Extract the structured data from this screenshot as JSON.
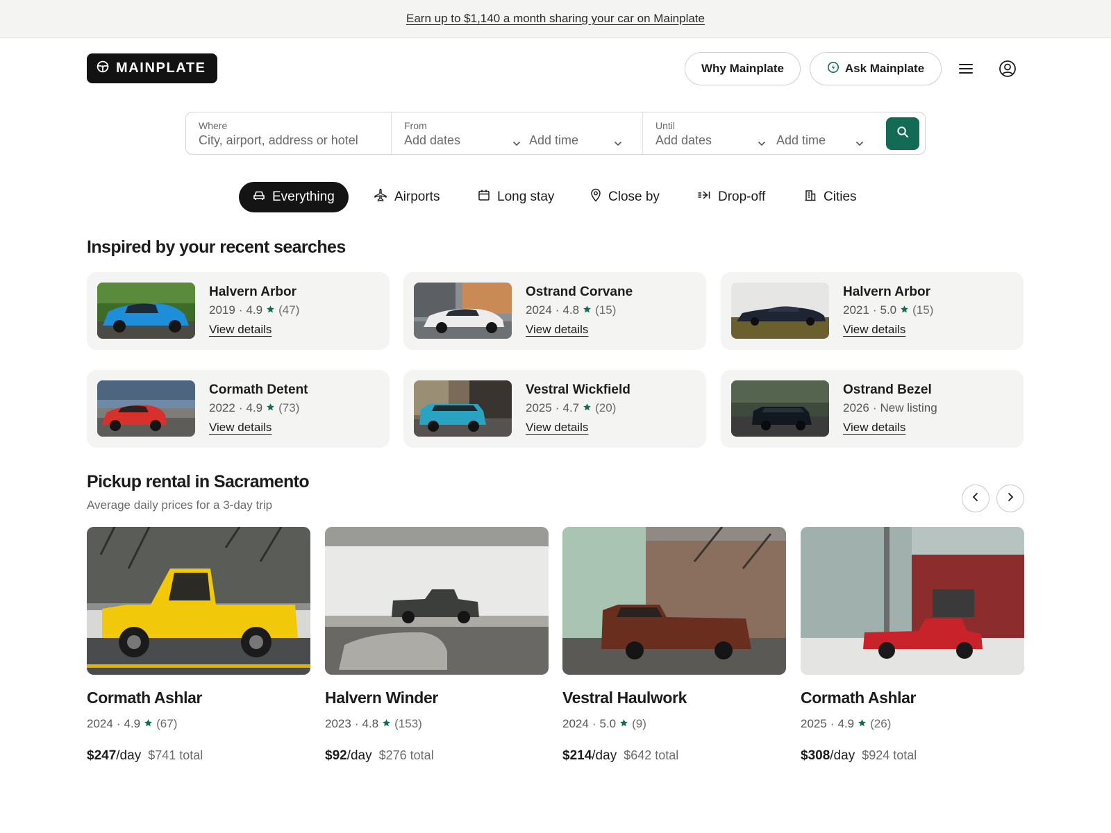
{
  "banner": {
    "text": "Earn up to $1,140 a month sharing your car on Mainplate"
  },
  "header": {
    "logo_text": "MAINPLATE",
    "why_label": "Why Mainplate",
    "ask_label": "Ask Mainplate",
    "menu_icon": "hamburger-icon",
    "account_icon": "account-icon"
  },
  "search": {
    "where_label": "Where",
    "where_placeholder": "City, airport, address or hotel",
    "from_label": "From",
    "from_date": "Add dates",
    "from_time": "Add time",
    "until_label": "Until",
    "until_date": "Add dates",
    "until_time": "Add time",
    "button_icon": "search-icon",
    "accent_color": "#136b55"
  },
  "categories": [
    {
      "label": "Everything",
      "icon": "car-icon",
      "active": true
    },
    {
      "label": "Airports",
      "icon": "airplane-icon"
    },
    {
      "label": "Long stay",
      "icon": "calendar-icon"
    },
    {
      "label": "Close by",
      "icon": "location-pin-icon"
    },
    {
      "label": "Drop-off",
      "icon": "drop-off-icon"
    },
    {
      "label": "Cities",
      "icon": "building-icon"
    }
  ],
  "recent": {
    "title": "Inspired by your recent searches",
    "link_label": "View details",
    "items": [
      {
        "name": "Halvern Arbor",
        "year": "2019",
        "rating": "4.9",
        "reviews": "(47)"
      },
      {
        "name": "Ostrand Corvane",
        "year": "2024",
        "rating": "4.8",
        "reviews": "(15)"
      },
      {
        "name": "Halvern Arbor",
        "year": "2021",
        "rating": "5.0",
        "reviews": "(15)"
      },
      {
        "name": "Cormath Detent",
        "year": "2022",
        "rating": "4.9",
        "reviews": "(73)"
      },
      {
        "name": "Vestral Wickfield",
        "year": "2025",
        "rating": "4.7",
        "reviews": "(20)"
      },
      {
        "name": "Ostrand Bezel",
        "year": "2026",
        "status": "New listing"
      }
    ]
  },
  "pickup": {
    "title": "Pickup rental in Sacramento",
    "subtitle": "Average daily prices for a 3-day trip",
    "unit": "/day",
    "items": [
      {
        "name": "Cormath Ashlar",
        "year": "2024",
        "rating": "4.9",
        "reviews": "(67)",
        "price": "$247",
        "total": "$741 total"
      },
      {
        "name": "Halvern Winder",
        "year": "2023",
        "rating": "4.8",
        "reviews": "(153)",
        "price": "$92",
        "total": "$276 total"
      },
      {
        "name": "Vestral Haulwork",
        "year": "2024",
        "rating": "5.0",
        "reviews": "(9)",
        "price": "$214",
        "total": "$642 total"
      },
      {
        "name": "Cormath Ashlar",
        "year": "2025",
        "rating": "4.9",
        "reviews": "(26)",
        "price": "$308",
        "total": "$924 total"
      }
    ]
  },
  "colors": {
    "star": "#136b55",
    "card_bg": "#f4f4f2"
  }
}
